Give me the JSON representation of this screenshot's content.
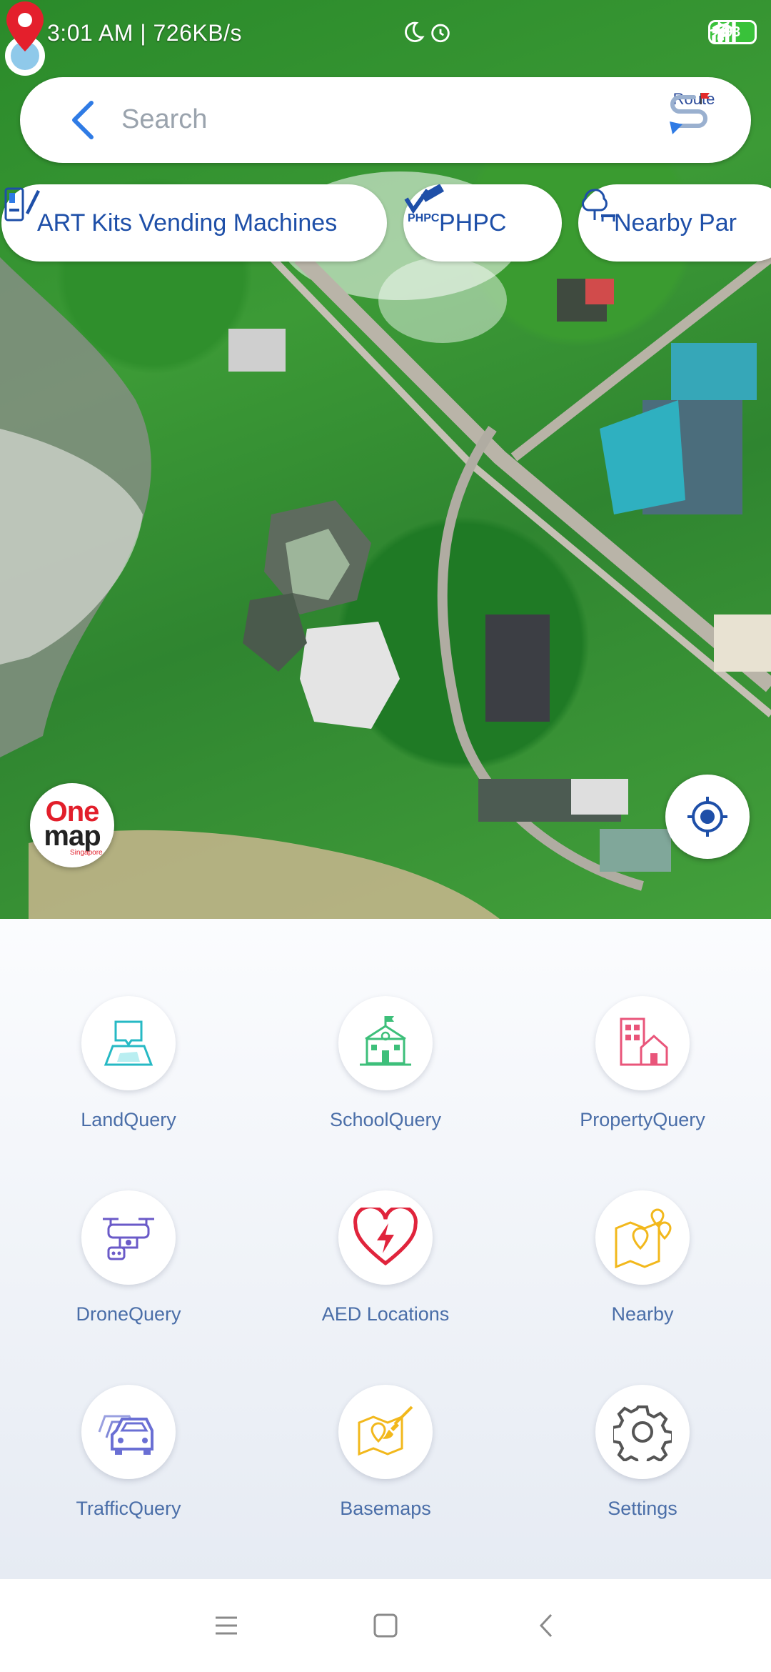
{
  "status_bar": {
    "time": "3:01 AM | 726KB/s",
    "battery": "93",
    "icons": [
      "moon-icon",
      "alarm-icon",
      "location-icon",
      "bluetooth-icon",
      "signal-icon",
      "wifi-icon",
      "battery-icon",
      "charging-icon"
    ]
  },
  "search": {
    "placeholder": "Search",
    "route_label": "Route"
  },
  "chips": [
    {
      "label": "ART Kits Vending Machines",
      "icon": "vending-machine-icon"
    },
    {
      "label": "PHPC",
      "icon": "phpc-ready-icon"
    },
    {
      "label": "Nearby Par",
      "icon": "park-bench-icon"
    }
  ],
  "logo": {
    "line1": "One",
    "line2": "map",
    "sub": "Singapore"
  },
  "menu": [
    {
      "label": "LandQuery",
      "icon": "land-query-icon",
      "color": "#26b9c4"
    },
    {
      "label": "SchoolQuery",
      "icon": "school-icon",
      "color": "#3dbf7a"
    },
    {
      "label": "PropertyQuery",
      "icon": "property-icon",
      "color": "#e9557a"
    },
    {
      "label": "DroneQuery",
      "icon": "drone-icon",
      "color": "#6a5ac8"
    },
    {
      "label": "AED Locations",
      "icon": "aed-heart-icon",
      "color": "#e0243c"
    },
    {
      "label": "Nearby",
      "icon": "nearby-map-icon",
      "color": "#f2b81c"
    },
    {
      "label": "TrafficQuery",
      "icon": "traffic-car-icon",
      "color": "#6a6fd4"
    },
    {
      "label": "Basemaps",
      "icon": "basemap-icon",
      "color": "#f2b81c"
    },
    {
      "label": "Settings",
      "icon": "gear-icon",
      "color": "#555555"
    }
  ],
  "navbar": [
    "menu-icon",
    "home-icon",
    "back-icon"
  ]
}
